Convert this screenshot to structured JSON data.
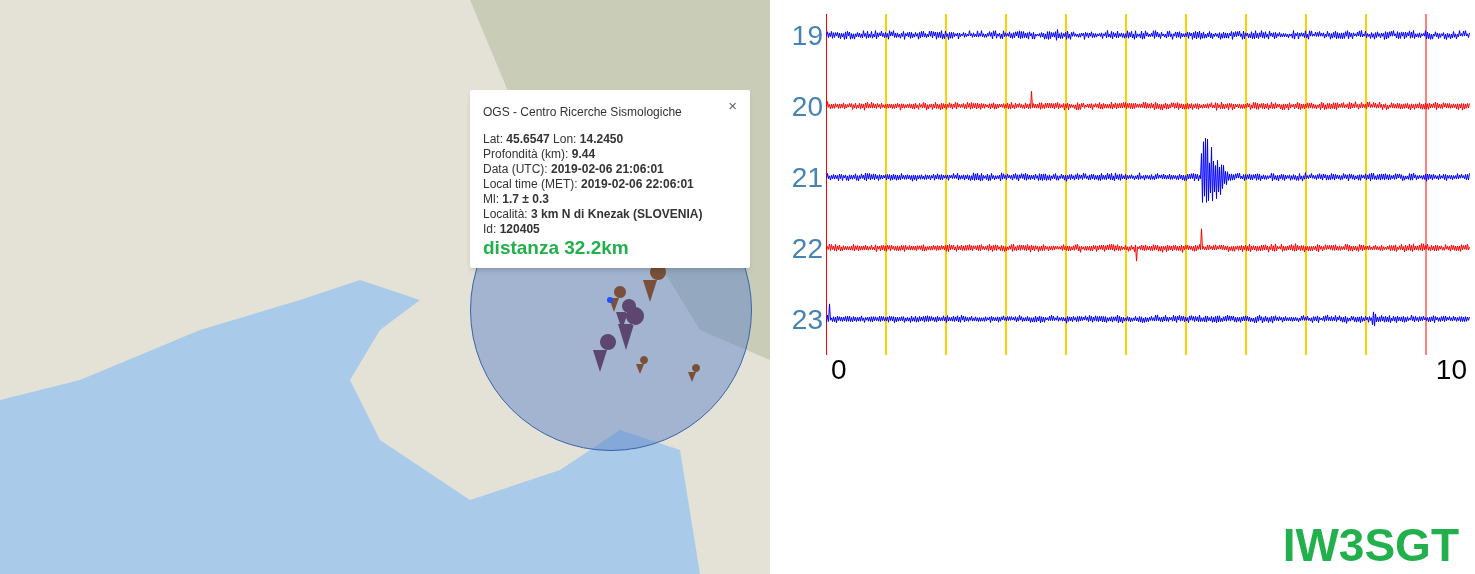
{
  "popup": {
    "source": "OGS - Centro Ricerche Sismologiche",
    "close": "×",
    "fields": [
      "Lat: **45.6547** Lon: **14.2450**",
      "Profondità (km): **9.44**",
      "Data (UTC): **2019-02-06 21:06:01**",
      "Local time (MET): **2019-02-06 22:06:01**",
      "Ml: **1.7 ± 0.3**",
      "Località: **3 km N di Knezak (SLOVENIA)**",
      "Id: **120405**"
    ],
    "distance": "distanza 32.2km"
  },
  "seismogram": {
    "traces": [
      {
        "hour": "19",
        "color": "#0000ff"
      },
      {
        "hour": "20",
        "color": "#ff0000"
      },
      {
        "hour": "21",
        "color": "#0000ff"
      },
      {
        "hour": "22",
        "color": "#ff0000"
      },
      {
        "hour": "23",
        "color": "#0000ff"
      }
    ],
    "axis_start": "0",
    "axis_end": "10"
  },
  "station": "IW3SGT"
}
